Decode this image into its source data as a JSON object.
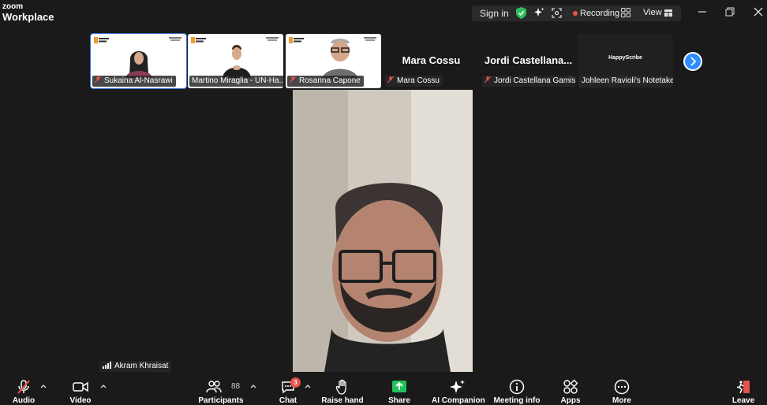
{
  "app": {
    "logo_line1": "zoom",
    "logo_line2": "Workplace"
  },
  "topbar": {
    "signin": "Sign in",
    "recording": "Recording",
    "view": "View"
  },
  "thumbnails": [
    {
      "name": "Sukaina Al-Nasrawi"
    },
    {
      "name": "Martino Miraglia - UN-Ha..."
    },
    {
      "name": "Rosanna Capone"
    },
    {
      "name": "Mara Cossu",
      "big": "Mara Cossu"
    },
    {
      "name": "Jordi Castellana Gamis...",
      "big": "Jordi  Castellana..."
    },
    {
      "name": "Johleen Ravioli's Notetaker",
      "brand": "HappyScribe"
    }
  ],
  "speaker": {
    "name": "Akram Khraisat"
  },
  "toolbar": {
    "audio": "Audio",
    "video": "Video",
    "participants": "Participants",
    "participants_count": "88",
    "chat": "Chat",
    "chat_badge": "3",
    "raise_hand": "Raise hand",
    "share": "Share",
    "ai_companion": "AI Companion",
    "meeting_info": "Meeting info",
    "apps": "Apps",
    "more": "More",
    "leave": "Leave"
  },
  "colors": {
    "accent": "#2d8cff",
    "share": "#20c15a",
    "danger": "#e8524c",
    "shield": "#2fbf5c"
  }
}
